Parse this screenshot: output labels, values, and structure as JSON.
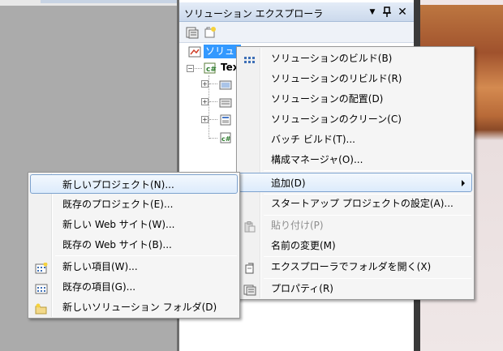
{
  "panel": {
    "title": "ソリューション エクスプローラ",
    "pin_glyph": "▼",
    "dock_glyph": "ᛗ",
    "close_glyph": "✕"
  },
  "tree": {
    "solution_label": "ソリュ",
    "project_label": "Tex"
  },
  "context_menu": {
    "items": [
      {
        "label": "ソリューションのビルド(B)",
        "icon": "build-solution-icon",
        "enabled": true
      },
      {
        "label": "ソリューションのリビルド(R)",
        "icon": "",
        "enabled": true
      },
      {
        "label": "ソリューションの配置(D)",
        "icon": "",
        "enabled": true
      },
      {
        "label": "ソリューションのクリーン(C)",
        "icon": "",
        "enabled": true
      },
      {
        "label": "バッチ ビルド(T)...",
        "icon": "",
        "enabled": true
      },
      {
        "label": "構成マネージャ(O)...",
        "icon": "",
        "enabled": true
      },
      {
        "label": "追加(D)",
        "icon": "",
        "enabled": true,
        "submenu": true,
        "highlighted": true
      },
      {
        "label": "スタートアップ プロジェクトの設定(A)...",
        "icon": "",
        "enabled": true
      },
      {
        "label": "貼り付け(P)",
        "icon": "paste-icon",
        "enabled": false
      },
      {
        "label": "名前の変更(M)",
        "icon": "",
        "enabled": true
      },
      {
        "label": "エクスプローラでフォルダを開く(X)",
        "icon": "open-folder-explorer-icon",
        "enabled": true
      },
      {
        "label": "プロパティ(R)",
        "icon": "properties-icon",
        "enabled": true
      }
    ]
  },
  "submenu": {
    "items": [
      {
        "label": "新しいプロジェクト(N)...",
        "icon": "",
        "highlighted": true
      },
      {
        "label": "既存のプロジェクト(E)...",
        "icon": ""
      },
      {
        "label": "新しい Web サイト(W)...",
        "icon": ""
      },
      {
        "label": "既存の Web サイト(B)...",
        "icon": ""
      },
      {
        "label": "新しい項目(W)...",
        "icon": "new-item-icon"
      },
      {
        "label": "既存の項目(G)...",
        "icon": "existing-item-icon"
      },
      {
        "label": "新しいソリューション フォルダ(D)",
        "icon": "new-solution-folder-icon"
      }
    ]
  }
}
